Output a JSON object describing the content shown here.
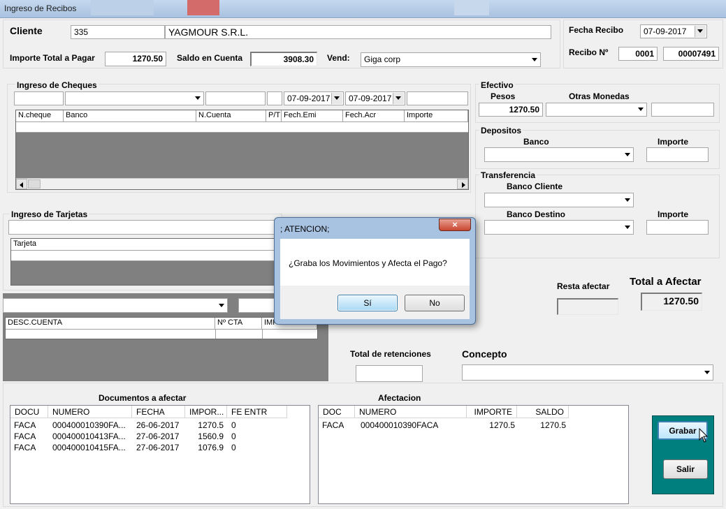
{
  "window": {
    "title": "Ingreso de Recibos"
  },
  "header": {
    "cliente_label": "Cliente",
    "cliente_codigo": "335",
    "cliente_nombre": "YAGMOUR S.R.L.",
    "importe_label": "Importe Total a Pagar",
    "importe_value": "1270.50",
    "saldo_label": "Saldo en Cuenta",
    "saldo_value": "3908.30",
    "vend_label": "Vend:",
    "vend_value": "Giga corp",
    "fecha_label": "Fecha Recibo",
    "fecha_value": "07-09-2017",
    "recibo_label": "Recibo Nº",
    "recibo_punto": "0001",
    "recibo_numero": "00007491"
  },
  "cheques": {
    "title": "Ingreso de Cheques",
    "fecha_emi": "07-09-2017",
    "fecha_acr": "07-09-2017",
    "columns": [
      "N.cheque",
      "Banco",
      "N.Cuenta",
      "P/T",
      "Fech.Emi",
      "Fech.Acr",
      "Importe"
    ]
  },
  "efectivo": {
    "title": "Efectivo",
    "pesos_label": "Pesos",
    "pesos_value": "1270.50",
    "otras_label": "Otras Monedas"
  },
  "depositos": {
    "title": "Depositos",
    "banco_label": "Banco",
    "importe_label": "Importe"
  },
  "transferencia": {
    "title": "Transferencia",
    "banco_cliente_label": "Banco Cliente",
    "banco_destino_label": "Banco Destino",
    "importe_label": "Importe"
  },
  "tarjetas": {
    "title": "Ingreso de Tarjetas",
    "columns": [
      "Tarjeta"
    ]
  },
  "cuentas": {
    "columns": [
      "DESC.CUENTA",
      "Nº CTA",
      "IMP"
    ]
  },
  "totales": {
    "resta_label": "Resta afectar",
    "total_afectar_label": "Total a Afectar",
    "total_afectar_value": "1270.50",
    "retenciones_label": "Total de retenciones",
    "concepto_label": "Concepto"
  },
  "documentos": {
    "title": "Documentos a afectar",
    "columns": [
      "DOCU",
      "NUMERO",
      "FECHA",
      "IMPOR...",
      "FE ENTR"
    ],
    "rows": [
      [
        "FACA",
        "000400010390FA...",
        "26-06-2017",
        "1270.5",
        "0"
      ],
      [
        "FACA",
        "000400010413FA...",
        "27-06-2017",
        "1560.9",
        "0"
      ],
      [
        "FACA",
        "000400010415FA...",
        "27-06-2017",
        "1076.9",
        "0"
      ]
    ]
  },
  "afectacion": {
    "title": "Afectacion",
    "columns": [
      "DOC",
      "NUMERO",
      "IMPORTE",
      "SALDO"
    ],
    "rows": [
      [
        "FACA",
        "000400010390FACA",
        "1270.5",
        "1270.5"
      ]
    ]
  },
  "actions": {
    "grabar": "Grabar",
    "salir": "Salir"
  },
  "dialog": {
    "title": "; ATENCION;",
    "close": "×",
    "message": "¿Graba los Movimientos y Afecta el Pago?",
    "yes": "Sí",
    "no": "No"
  }
}
